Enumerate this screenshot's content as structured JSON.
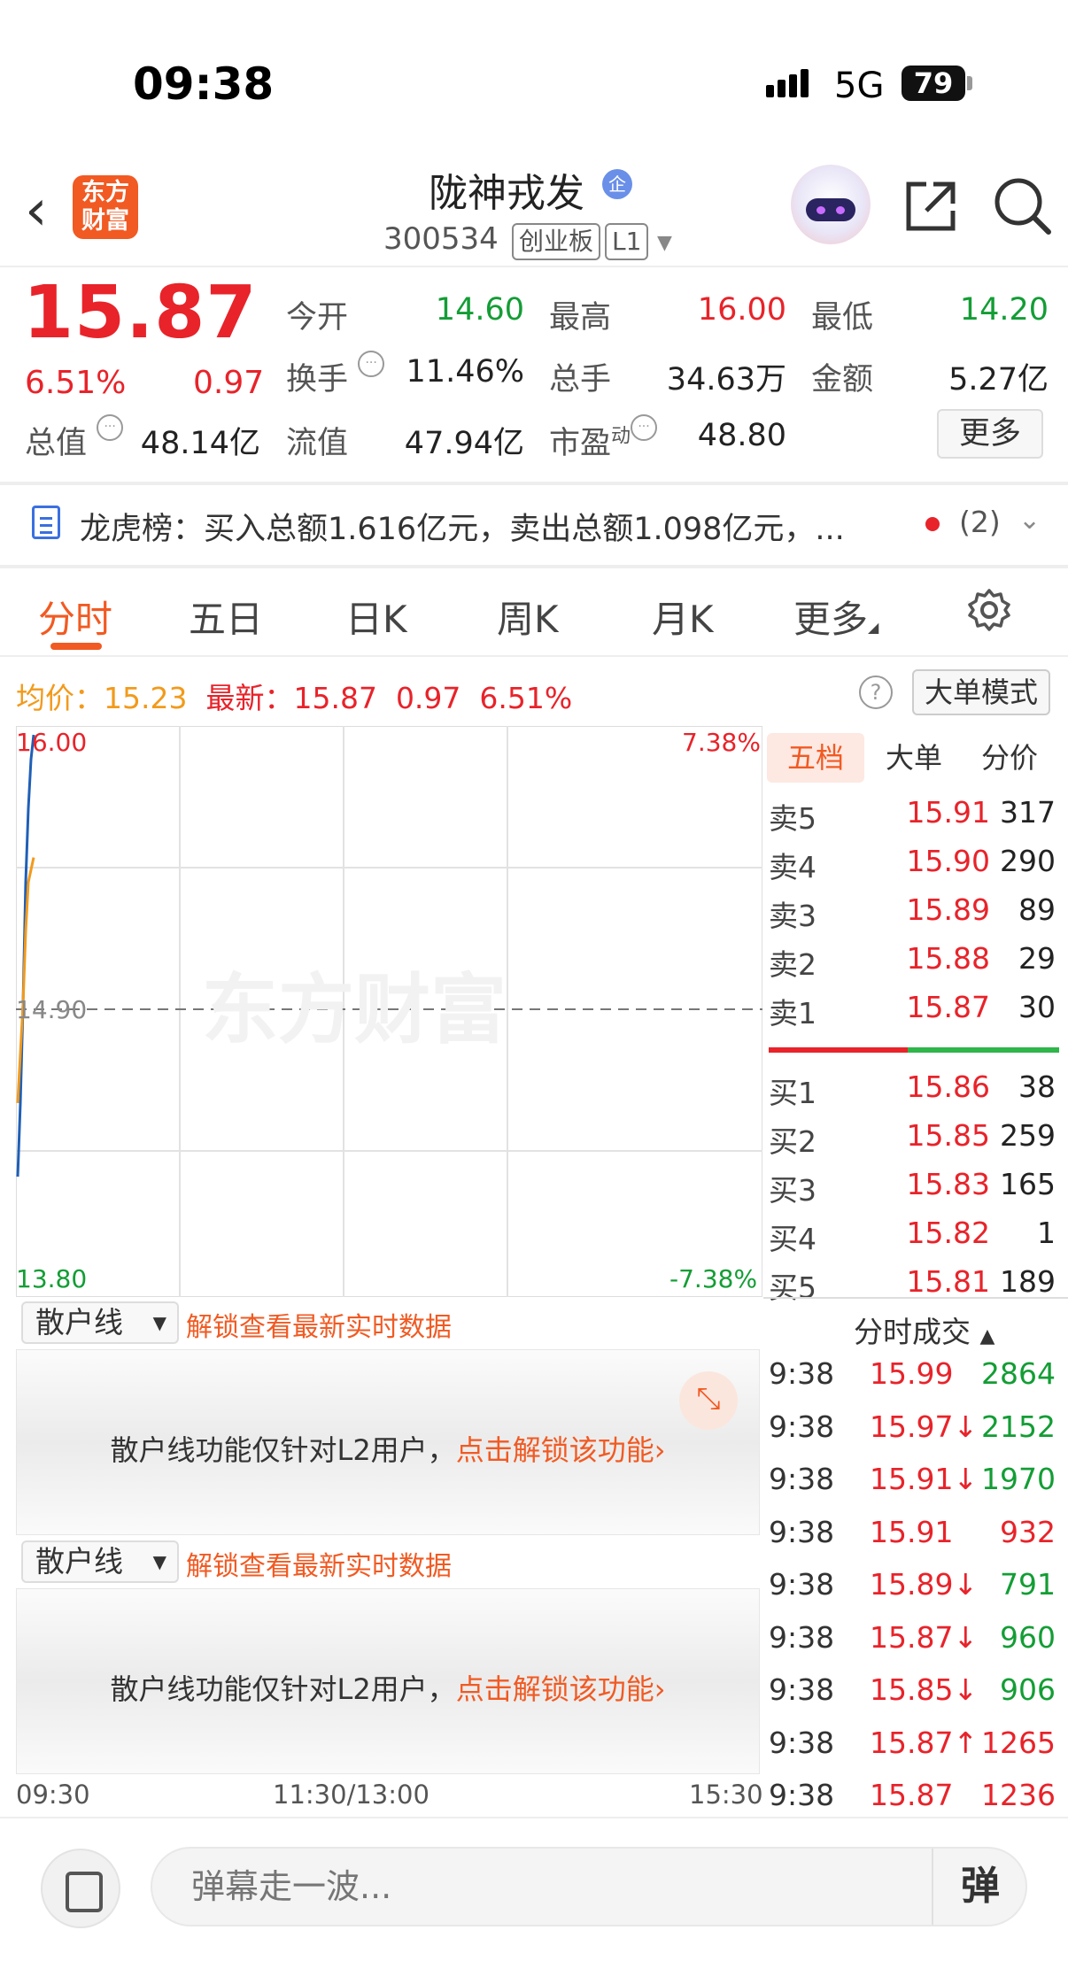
{
  "status_bar": {
    "time": "09:38",
    "network": "5G",
    "battery": "79"
  },
  "header": {
    "back_icon": "chevron-left-icon",
    "logo_text": "东方\n财富",
    "stock_name": "陇神戎发",
    "badge": "企",
    "code": "300534",
    "board_tag": "创业板",
    "level_tag": "L1"
  },
  "quote": {
    "price": "15.87",
    "change_pct": "6.51%",
    "change": "0.97",
    "fields": [
      {
        "label": "今开",
        "value": "14.60",
        "color": "green"
      },
      {
        "label": "最高",
        "value": "16.00",
        "color": "red"
      },
      {
        "label": "最低",
        "value": "14.20",
        "color": "green"
      },
      {
        "label": "换手",
        "value": "11.46%",
        "color": "dark"
      },
      {
        "label": "总手",
        "value": "34.63万",
        "color": "dark"
      },
      {
        "label": "金额",
        "value": "5.27亿",
        "color": "dark"
      },
      {
        "label": "总值",
        "value": "48.14亿",
        "color": "dark"
      },
      {
        "label": "流值",
        "value": "47.94亿",
        "color": "dark"
      },
      {
        "label": "市盈",
        "sup": "动",
        "value": "48.80",
        "color": "dark"
      }
    ],
    "more_button": "更多"
  },
  "dragon_tiger": {
    "text": "龙虎榜：买入总额1.616亿元，卖出总额1.098亿元，...",
    "count": "(2)"
  },
  "tabs": [
    "分时",
    "五日",
    "日K",
    "周K",
    "月K",
    "更多"
  ],
  "avg_line": {
    "avg_label": "均价：",
    "avg_value": "15.23",
    "latest_label": "最新：",
    "latest_value": "15.87",
    "latest_change": "0.97",
    "latest_pct": "6.51%",
    "help_icon": "?",
    "big_order_button": "大单模式"
  },
  "chart_data": {
    "type": "line",
    "watermark": "东方财富",
    "y_labels": {
      "top": "16.00",
      "mid": "14.90",
      "bottom": "13.80"
    },
    "pct_labels": {
      "top": "7.38%",
      "bottom": "-7.38%"
    },
    "ylim": [
      13.8,
      16.0
    ],
    "x_labels": [
      "09:30",
      "11:30/13:00",
      "15:30"
    ],
    "series": [
      {
        "color": "#1f5fb7",
        "values": [
          14.2,
          14.5,
          14.9,
          15.4,
          15.7,
          15.9,
          16.0
        ]
      },
      {
        "color": "#f29a1b",
        "values": [
          14.5,
          14.7,
          14.9,
          15.2,
          15.4,
          15.45,
          15.5
        ]
      }
    ]
  },
  "order_book": {
    "tabs": [
      "五档",
      "大单",
      "分价"
    ],
    "asks": [
      {
        "label": "卖5",
        "price": "15.91",
        "volume": "317"
      },
      {
        "label": "卖4",
        "price": "15.90",
        "volume": "290"
      },
      {
        "label": "卖3",
        "price": "15.89",
        "volume": "89"
      },
      {
        "label": "卖2",
        "price": "15.88",
        "volume": "29"
      },
      {
        "label": "卖1",
        "price": "15.87",
        "volume": "30"
      }
    ],
    "bids": [
      {
        "label": "买1",
        "price": "15.86",
        "volume": "38"
      },
      {
        "label": "买2",
        "price": "15.85",
        "volume": "259"
      },
      {
        "label": "买3",
        "price": "15.83",
        "volume": "165"
      },
      {
        "label": "买4",
        "price": "15.82",
        "volume": "1"
      },
      {
        "label": "买5",
        "price": "15.81",
        "volume": "189"
      }
    ]
  },
  "ticks": {
    "header": "分时成交",
    "rows": [
      {
        "time": "9:38",
        "price": "15.99",
        "volume": "2864",
        "vcolor": "green"
      },
      {
        "time": "9:38",
        "price": "15.97↓",
        "volume": "2152",
        "vcolor": "green"
      },
      {
        "time": "9:38",
        "price": "15.91↓",
        "volume": "1970",
        "vcolor": "green"
      },
      {
        "time": "9:38",
        "price": "15.91",
        "volume": "932",
        "vcolor": "red"
      },
      {
        "time": "9:38",
        "price": "15.89↓",
        "volume": "791",
        "vcolor": "green"
      },
      {
        "time": "9:38",
        "price": "15.87↓",
        "volume": "960",
        "vcolor": "green"
      },
      {
        "time": "9:38",
        "price": "15.85↓",
        "volume": "906",
        "vcolor": "green"
      },
      {
        "time": "9:38",
        "price": "15.87↑",
        "volume": "1265",
        "vcolor": "red"
      },
      {
        "time": "9:38",
        "price": "15.87",
        "volume": "1236",
        "vcolor": "red"
      }
    ]
  },
  "retail_panels": [
    {
      "select": "散户线",
      "unlock": "解锁查看最新实时数据",
      "msg": "散户线功能仅针对L2用户，",
      "msg_link": "点击解锁该功能›"
    },
    {
      "select": "散户线",
      "unlock": "解锁查看最新实时数据",
      "msg": "散户线功能仅针对L2用户，",
      "msg_link": "点击解锁该功能›"
    }
  ],
  "bottom": {
    "placeholder": "弹幕走一波...",
    "danmaku_button": "弹"
  }
}
